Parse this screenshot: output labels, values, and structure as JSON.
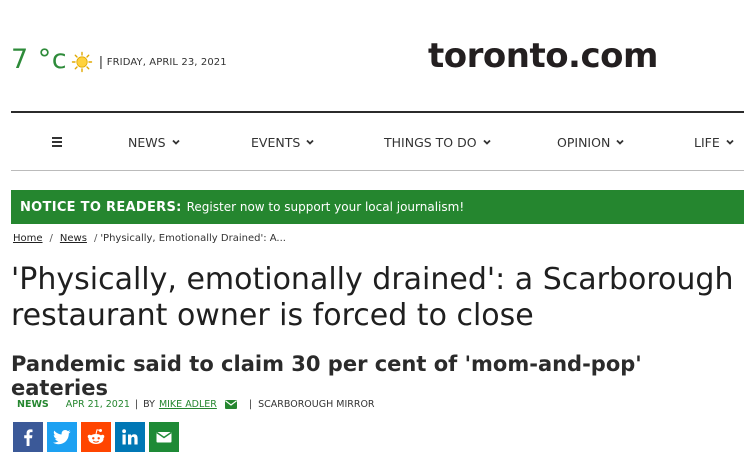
{
  "weather": {
    "temperature": "7 °c",
    "icon": "sun-icon",
    "separator": "|",
    "date": "FRIDAY, APRIL 23, 2021"
  },
  "brand": {
    "logo": "toronto.com"
  },
  "nav": {
    "menu_icon": "hamburger-icon",
    "items": [
      {
        "label": "NEWS"
      },
      {
        "label": "EVENTS"
      },
      {
        "label": "THINGS TO DO"
      },
      {
        "label": "OPINION"
      },
      {
        "label": "LIFE"
      }
    ]
  },
  "notice": {
    "title": "NOTICE TO READERS:",
    "text": "Register now to support your local journalism!"
  },
  "breadcrumb": {
    "home": "Home",
    "sep": "/",
    "news": "News",
    "current": "'Physically, Emotionally Drained': A..."
  },
  "article": {
    "headline": "'Physically, emotionally drained': a Scarborough restaurant owner is forced to close",
    "subhead": "Pandemic said to claim 30 per cent of 'mom-and-pop' eateries",
    "section": "NEWS",
    "date": "APR 21, 2021",
    "bar": "|",
    "by": "BY",
    "author": "MIKE ADLER",
    "source": "SCARBOROUGH MIRROR"
  },
  "share": [
    "facebook-icon",
    "twitter-icon",
    "reddit-icon",
    "linkedin-icon",
    "email-icon"
  ],
  "colors": {
    "accent": "#25862f",
    "facebook": "#3b5998",
    "twitter": "#1da1f2",
    "reddit": "#ff4500",
    "linkedin": "#0077b5"
  }
}
